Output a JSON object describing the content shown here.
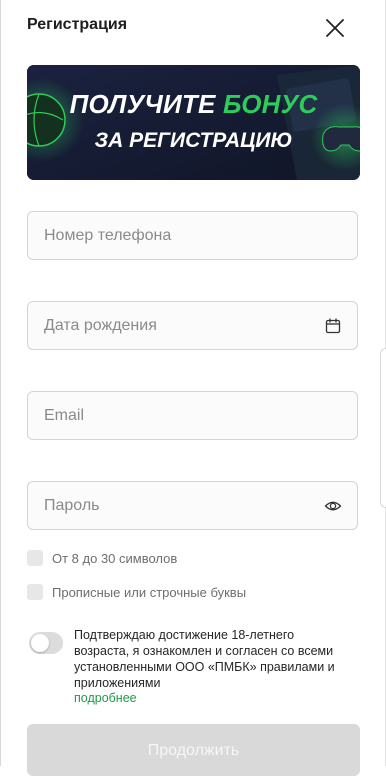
{
  "header": {
    "title": "Регистрация"
  },
  "banner": {
    "line1_main": "ПОЛУЧИТЕ",
    "line1_accent": "БОНУС",
    "line2": "ЗА РЕГИСТРАЦИЮ"
  },
  "form": {
    "phone": {
      "placeholder": "Номер телефона",
      "value": ""
    },
    "birthdate": {
      "placeholder": "Дата рождения",
      "value": ""
    },
    "email": {
      "placeholder": "Email",
      "value": ""
    },
    "password": {
      "placeholder": "Пароль",
      "value": ""
    }
  },
  "password_rules": [
    {
      "label": "От 8 до 30 символов"
    },
    {
      "label": "Прописные или строчные буквы"
    }
  ],
  "consent": {
    "text": "Подтверждаю достижение 18-летнего возраста, я ознакомлен и согласен со всеми установленными ООО «ПМБК» правилами и приложениями",
    "link": "подробнее",
    "checked": false
  },
  "actions": {
    "continue_label": "Продолжить",
    "enabled": false
  },
  "colors": {
    "accent": "#2ecc5a",
    "link": "#1f9a4a",
    "banner_bg": "#141a2e",
    "disabled_button": "#d9d9d9"
  },
  "icons": {
    "close": "close-icon",
    "calendar": "calendar-icon",
    "eye": "eye-icon"
  }
}
